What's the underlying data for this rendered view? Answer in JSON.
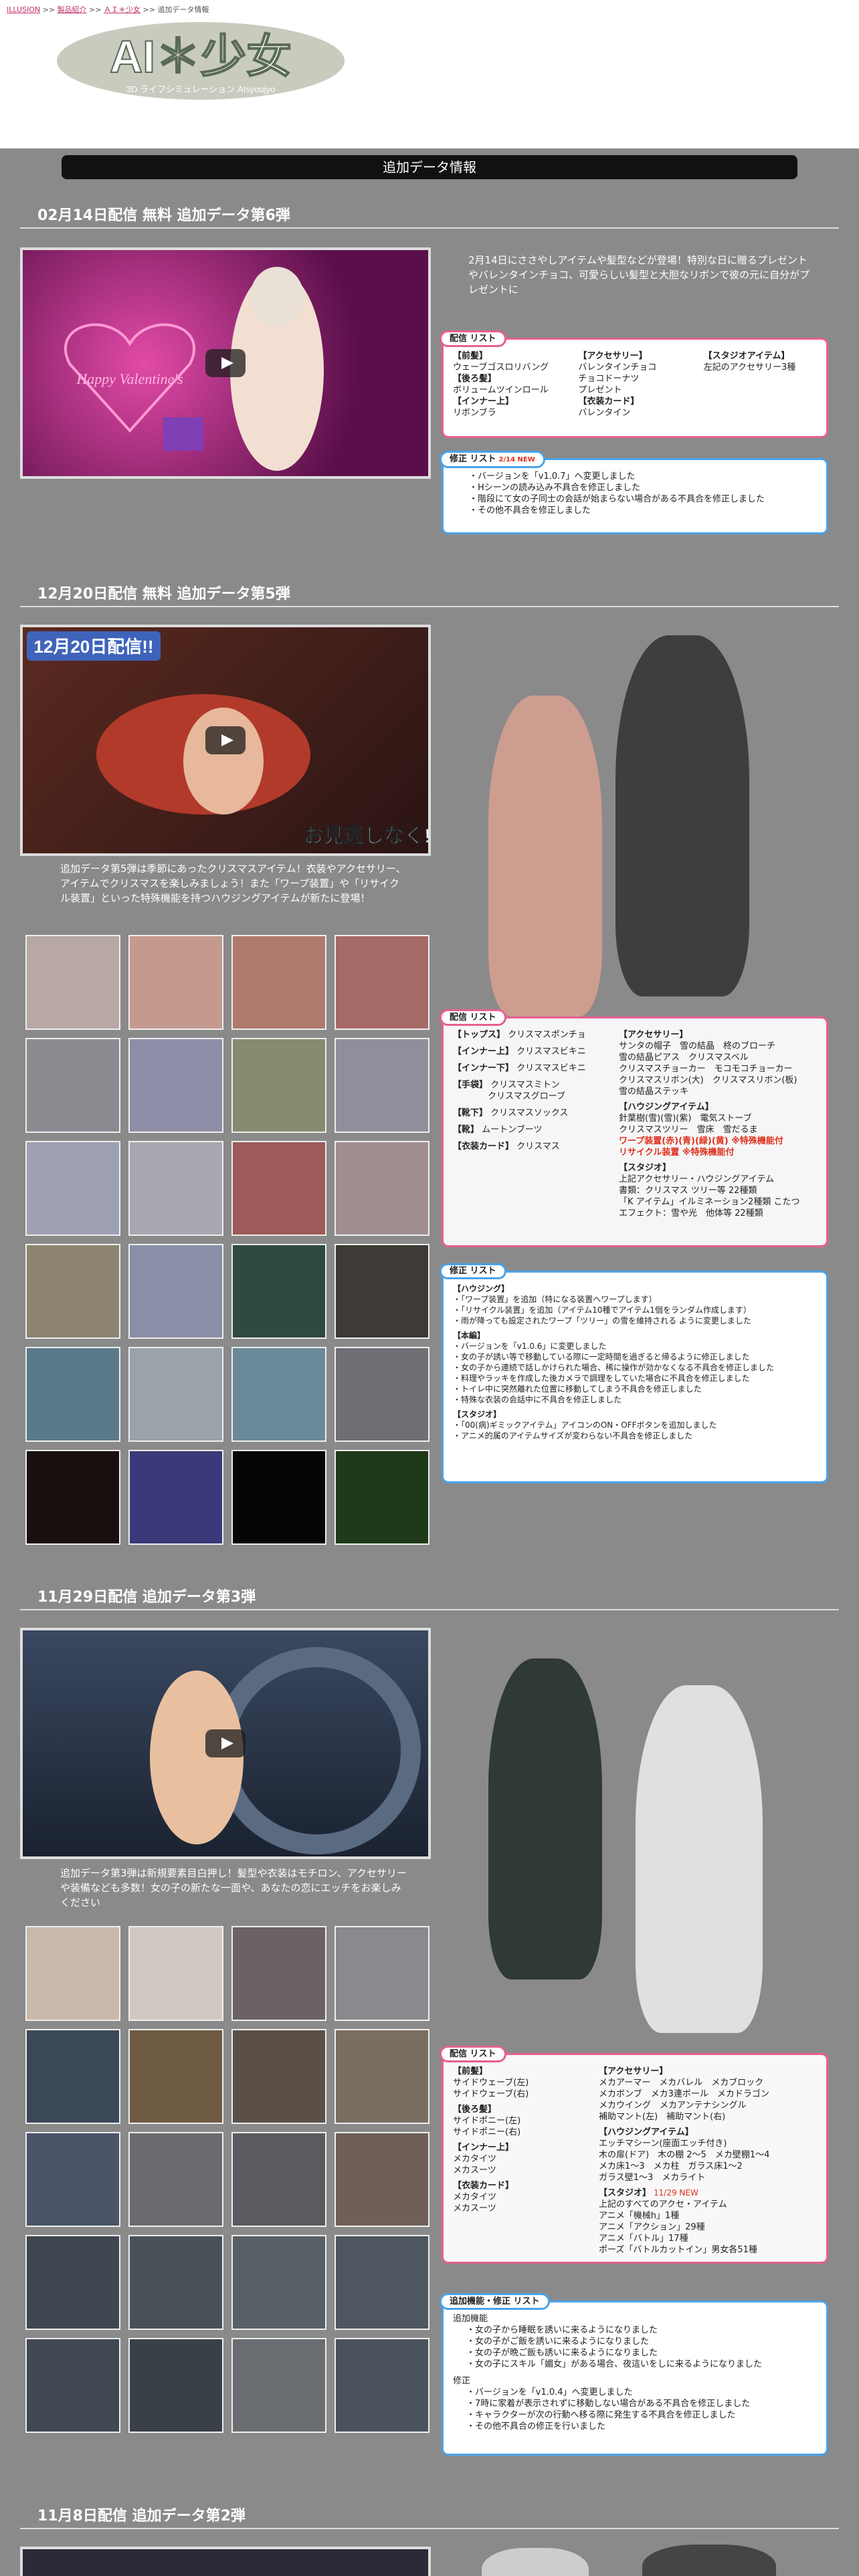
{
  "breadcrumb": [
    "ILLUSION",
    "製品紹介",
    "ＡＩ＊少女",
    "追加データ情報"
  ],
  "logo": {
    "title": "AI＊少女",
    "subtitle": "3D ライフシミュレーション AIsyoujyo"
  },
  "banner": "追加データ情報",
  "sections": [
    {
      "title": "02月14日配信 無料 追加データ第6弾",
      "video_text": "Happy Valentine's",
      "desc": "2月14日にささやしアイテムや髪型などが登場！特別な日に贈るプレゼントやバレンタインチョコ、可愛らしい髪型と大胆なリボンで彼の元に自分がプレゼントに",
      "dist": {
        "label": "配信 リスト",
        "col1": [
          {
            "h": "【前髪】",
            "items": [
              "ウェーブゴスロリバング"
            ]
          },
          {
            "h": "【後ろ髪】",
            "items": [
              "ボリュームツインロール"
            ]
          },
          {
            "h": "【インナー上】",
            "items": [
              "リボンブラ"
            ]
          }
        ],
        "col2": [
          {
            "h": "【アクセサリー】",
            "items": [
              "バレンタインチョコ",
              "チョコドーナツ",
              "プレゼント"
            ]
          },
          {
            "h": "【衣装カード】",
            "items": [
              "バレンタイン"
            ]
          }
        ],
        "col3": [
          {
            "h": "【スタジオアイテム】",
            "items": [
              "左記のアクセサリー3種"
            ]
          }
        ]
      },
      "fix": {
        "label": "修正 リスト",
        "new": "2/14 NEW",
        "items": [
          "バージョンを「v1.0.7」へ変更しました",
          "Hシーンの読み込み不具合を修正しました",
          "階段にて女の子同士の会話が始まらない場合がある不具合を修正しました",
          "その他不具合を修正しました"
        ]
      }
    },
    {
      "title": "12月20日配信 無料 追加データ第5弾",
      "video_text1": "12月20日配信!!",
      "video_text2": "お見逃しなく!!",
      "desc": "追加データ第5弾は季節にあったクリスマスアイテム！衣装やアクセサリー、アイテムでクリスマスを楽しみましょう！また「ワープ装置」や「リサイクル装置」といった特殊機能を持つハウジングアイテムが新たに登場！",
      "dist": {
        "label": "配信 リスト",
        "col1": [
          {
            "h": "【トップス】",
            "items": [
              "クリスマスポンチョ"
            ]
          },
          {
            "h": "【インナー上】",
            "items": [
              "クリスマスビキニ"
            ]
          },
          {
            "h": "【インナー下】",
            "items": [
              "クリスマスビキニ"
            ]
          },
          {
            "h": "【手袋】",
            "items": [
              "クリスマスミトン",
              "クリスマスグローブ"
            ]
          },
          {
            "h": "【靴下】",
            "items": [
              "クリスマスソックス"
            ]
          },
          {
            "h": "【靴】",
            "items": [
              "ムートンブーツ"
            ]
          },
          {
            "h": "【衣装カード】",
            "items": [
              "クリスマス"
            ]
          }
        ],
        "col2": [
          {
            "h": "【アクセサリー】",
            "items": [
              "サンタの帽子　雪の結晶　柊のブローチ",
              "雪の結晶ピアス　クリスマスベル",
              "クリスマスチョーカー　モコモコチョーカー",
              "クリスマスリボン(大)　クリスマスリボン(板)",
              "雪の結晶ステッキ"
            ]
          },
          {
            "h": "【ハウジングアイテム】",
            "items": [
              "針葉樹(雪)(雪)(紫)　電気ストーブ",
              "クリスマスツリー　雪床　雪だるま"
            ]
          }
        ],
        "red": [
          "ワープ装置(赤)(青)(緑)(黄) ※特殊機能付",
          "リサイクル装置 ※特殊機能付"
        ],
        "col3": [
          {
            "h": "【スタジオ】",
            "items": [
              "上記アクセサリー・ハウジングアイテム",
              "書類：クリスマス ツリー等 22種類",
              "「K アイテム」イルミネーション2種類 こたつ",
              "エフェクト：雪や光　他体等 22種類"
            ]
          }
        ]
      },
      "fix": {
        "label": "修正 リスト",
        "groups": [
          {
            "h": "【ハウジング】",
            "items": [
              "「ワープ装置」を追加（特になる装置へワープします）",
              "「リサイクル装置」を追加（アイテム10種でアイテム1個をランダム作成します）",
              "雨が降っても設定されたワープ「ツリー」の雪を維持される ように変更しました"
            ]
          },
          {
            "h": "【本編】",
            "items": [
              "バージョンを「v1.0.6」に変更しました",
              "女の子が誘い等で移動している際に一定時間を過ぎると帰るように修正しました",
              "女の子から連続で話しかけられた場合、稀に操作が効かなくなる不具合を修正しました",
              "料理やラッキを作成した後カメラで調理をしていた場合に不具合を修正しました",
              "トイレ中に突然離れた位置に移動してしまう不具合を修正しました",
              "特殊な衣装の会話中に不具合を修正しました"
            ]
          },
          {
            "h": "【スタジオ】",
            "items": [
              "「00(病)ギミックアイテム」アイコンのON・OFFボタンを追加しました",
              "アニメ的属のアイテムサイズが変わらない不具合を修正しました"
            ]
          }
        ]
      }
    },
    {
      "title": "11月29日配信 追加データ第3弾",
      "desc": "追加データ第3弾は新規要素目白押し！髪型や衣装はモチロン、アクセサリーや装備なども多数！女の子の新たな一面や、あなたの恋にエッチをお楽しみください",
      "dist": {
        "label": "配信 リスト",
        "col1": [
          {
            "h": "【前髪】",
            "items": [
              "サイドウェーブ(左)",
              "サイドウェーブ(右)"
            ]
          },
          {
            "h": "【後ろ髪】",
            "items": [
              "サイドポニー(左)",
              "サイドポニー(右)"
            ]
          },
          {
            "h": "【インナー上】",
            "items": [
              "メカタイツ",
              "メカスーツ"
            ]
          },
          {
            "h": "【衣装カード】",
            "items": [
              "メカタイツ",
              "メカスーツ"
            ]
          }
        ],
        "col2": [
          {
            "h": "【アクセサリー】",
            "items": [
              "メカアーマー　メカバレル　メカブロック",
              "メカボンブ　メカ3連ボール　メカドラゴン",
              "メカウイング　メカアンテナシングル",
              "補助マント(左)　補助マント(右)"
            ]
          },
          {
            "h": "【ハウジングアイテム】",
            "items": [
              "エッチマシーン(座面エッチ付き)",
              "木の扉(ドア)　木の棚 2〜5　メカ壁棚1〜4",
              "メカ床1〜3　メカ柱　ガラス床1〜2",
              "ガラス壁1〜3　メカライト"
            ]
          },
          {
            "h": "【スタジオ】",
            "items": [
              "上記のすべてのアクセ・アイテム",
              "アニメ「機械h」1種",
              "アニメ「アクション」29種",
              "アニメ「バトル」17種",
              "ポーズ「バトルカットイン」男女各51種"
            ]
          }
        ],
        "new": "11/29 NEW"
      },
      "fix": {
        "label": "追加機能・修正 リスト",
        "add_h": "追加機能",
        "add": [
          "女の子から睡眠を誘いに来るようになりました",
          "女の子がご飯を誘いに来るようになりました",
          "女の子が晩ご飯も誘いに来るようになりました",
          "女の子にスキル「媚女」がある場合、夜這いをしに来るようになりました"
        ],
        "fix_h": "修正",
        "fix": [
          "バージョンを「v1.0.4」へ変更しました",
          "7時に家着が表示されずに移動しない場合がある不具合を修正しました",
          "キャラクターが次の行動へ移る際に発生する不具合を修正しました",
          "その他不具合の修正を行いました"
        ]
      }
    },
    {
      "title": "11月8日配信 追加データ第2弾"
    }
  ],
  "colors": {
    "pink": "#e75f93",
    "blue": "#4aa3e8",
    "bg": "#8a8a8a",
    "red": "#e0301e"
  }
}
